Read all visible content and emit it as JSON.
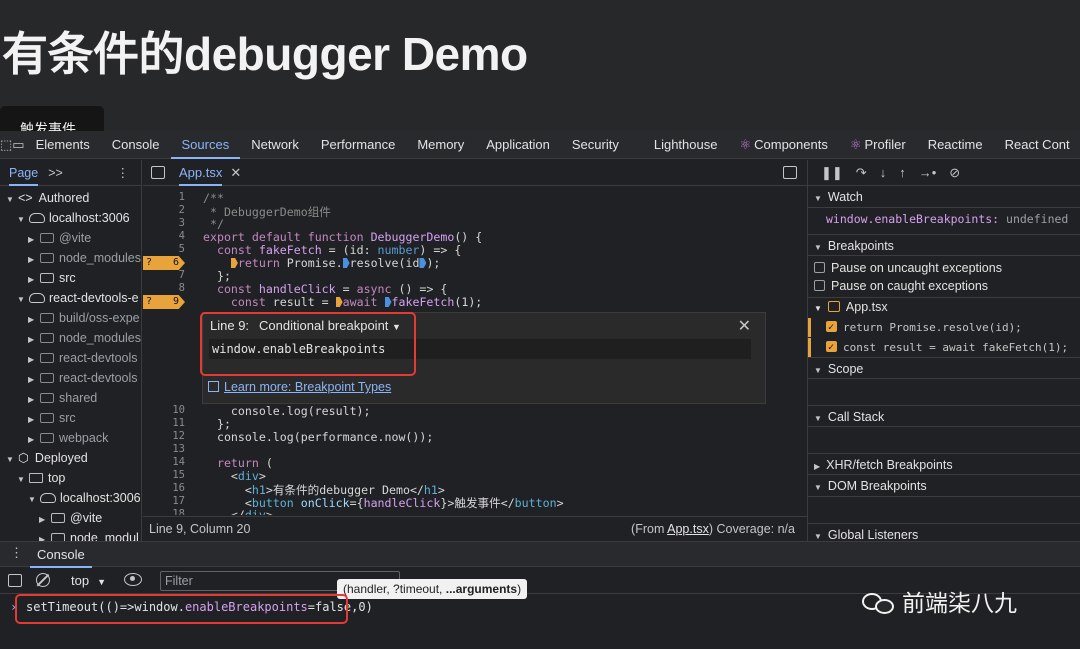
{
  "page": {
    "title": "有条件的debugger Demo",
    "trigger_button": "触发事件"
  },
  "devtools": {
    "tabs": [
      "Elements",
      "Console",
      "Sources",
      "Network",
      "Performance",
      "Memory",
      "Application",
      "Security",
      "Lighthouse",
      "Components",
      "Profiler",
      "Reactime",
      "React Cont"
    ],
    "active_tab": "Sources",
    "navigator": {
      "tab": "Page",
      "more": ">>",
      "tree": [
        {
          "label": "Authored",
          "indent": 0,
          "kind": "code",
          "open": true
        },
        {
          "label": "localhost:3006",
          "indent": 1,
          "kind": "cloud",
          "open": true
        },
        {
          "label": "@vite",
          "indent": 2,
          "kind": "folder",
          "dim": true
        },
        {
          "label": "node_modules",
          "indent": 2,
          "kind": "folder",
          "dim": true
        },
        {
          "label": "src",
          "indent": 2,
          "kind": "folder",
          "dim": false
        },
        {
          "label": "react-devtools-e",
          "indent": 1,
          "kind": "cloud",
          "open": true
        },
        {
          "label": "build/oss-expe",
          "indent": 2,
          "kind": "folder",
          "dim": true
        },
        {
          "label": "node_modules",
          "indent": 2,
          "kind": "folder",
          "dim": true
        },
        {
          "label": "react-devtools",
          "indent": 2,
          "kind": "folder",
          "dim": true
        },
        {
          "label": "react-devtools",
          "indent": 2,
          "kind": "folder",
          "dim": true
        },
        {
          "label": "shared",
          "indent": 2,
          "kind": "folder",
          "dim": true
        },
        {
          "label": "src",
          "indent": 2,
          "kind": "folder",
          "dim": true
        },
        {
          "label": "webpack",
          "indent": 2,
          "kind": "folder",
          "dim": true
        },
        {
          "label": "Deployed",
          "indent": 0,
          "kind": "box",
          "open": true
        },
        {
          "label": "top",
          "indent": 1,
          "kind": "frame",
          "open": true
        },
        {
          "label": "localhost:3006",
          "indent": 2,
          "kind": "cloud",
          "open": true
        },
        {
          "label": "@vite",
          "indent": 3,
          "kind": "folder",
          "dim": false
        },
        {
          "label": "node_modul",
          "indent": 3,
          "kind": "folder",
          "dim": false
        }
      ]
    },
    "editor": {
      "file_tab": "App.tsx",
      "lines_top": [
        {
          "n": "1",
          "code": "/**"
        },
        {
          "n": "2",
          "code": " * DebuggerDemo组件"
        },
        {
          "n": "3",
          "code": " */"
        },
        {
          "n": "4",
          "code": "export default function DebuggerDemo() {"
        },
        {
          "n": "5",
          "code": "  const fakeFetch = (id: number) => {"
        },
        {
          "n": "6",
          "code": "    return Promise.resolve(id);",
          "bp": "?"
        },
        {
          "n": "7",
          "code": "  };"
        },
        {
          "n": "8",
          "code": "  const handleClick = async () => {"
        },
        {
          "n": "9",
          "code": "    const result = await fakeFetch(1);",
          "bp": "?"
        }
      ],
      "lines_bottom": [
        {
          "n": "10",
          "code": "    console.log(result);"
        },
        {
          "n": "11",
          "code": "  };"
        },
        {
          "n": "12",
          "code": "  console.log(performance.now());"
        },
        {
          "n": "13",
          "code": ""
        },
        {
          "n": "14",
          "code": "  return ("
        },
        {
          "n": "15",
          "code": "    <div>"
        },
        {
          "n": "16",
          "code": "      <h1>有条件的debugger Demo</h1>"
        },
        {
          "n": "17",
          "code": "      <button onClick={handleClick}>触发事件</button>"
        },
        {
          "n": "18",
          "code": "    </div>"
        }
      ],
      "popup": {
        "line": "Line 9:",
        "kind": "Conditional breakpoint",
        "condition": "window.enableBreakpoints",
        "learn_more": "Learn more: Breakpoint Types"
      },
      "status_left": "Line 9, Column 20",
      "status_from": "(From ",
      "status_file": "App.tsx",
      "status_cov": ") Coverage: n/a"
    },
    "debugger": {
      "watch_title": "Watch",
      "watch_expr": "window.enableBreakpoints",
      "watch_value": "undefined",
      "breakpoints_title": "Breakpoints",
      "pause_uncaught": "Pause on uncaught exceptions",
      "pause_caught": "Pause on caught exceptions",
      "bp_file": "App.tsx",
      "bp_items": [
        "return Promise.resolve(id);",
        "const result = await fakeFetch(1);"
      ],
      "scope_title": "Scope",
      "callstack_title": "Call Stack",
      "xhr_title": "XHR/fetch Breakpoints",
      "dom_title": "DOM Breakpoints",
      "global_title": "Global Listeners"
    },
    "console": {
      "tab": "Console",
      "context": "top",
      "filter_placeholder": "Filter",
      "tooltip_prefix": "(handler, ?timeout, ",
      "tooltip_bold": "...arguments",
      "tooltip_suffix": ")",
      "command_pre": "setTimeout(()=>window.",
      "command_prop": "enableBreakpoints",
      "command_post": "=false,0)"
    }
  },
  "watermark": "前端柒八九",
  "colors": {
    "accent": "#8ab4f8",
    "breakpoint": "#e8a33a",
    "highlight_box": "#e53935"
  }
}
